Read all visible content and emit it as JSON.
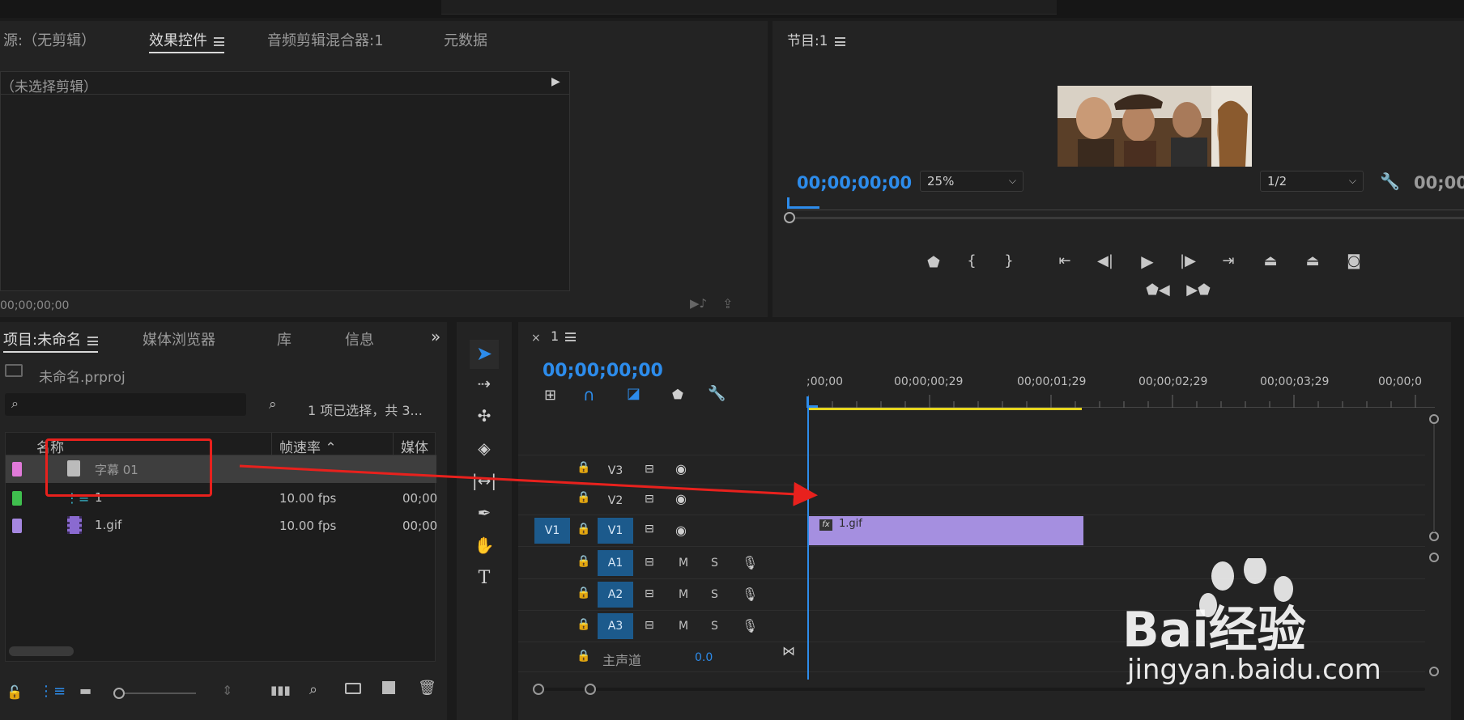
{
  "source_panel": {
    "tabs": [
      "源:（无剪辑）",
      "效果控件",
      "音频剪辑混合器:1",
      "元数据"
    ],
    "active_tab": 1,
    "no_clip_label": "（未选择剪辑）",
    "timecode": "00;00;00;00"
  },
  "program_monitor": {
    "title": "节目:1",
    "timecode": "00;00;00;00",
    "timecode_right": "00;00;",
    "zoom": "25%",
    "resolution": "1/2"
  },
  "project_panel": {
    "tabs": [
      "项目:未命名",
      "媒体浏览器",
      "库",
      "信息"
    ],
    "project_file": "未命名.prproj",
    "selection_status": "1 项已选择，共 3...",
    "columns": [
      "名称",
      "帧速率",
      "媒体"
    ],
    "items": [
      {
        "name": "字幕 01",
        "fps": "",
        "media": "",
        "color": "#e07ad9",
        "icon": "title-icon",
        "selected": true
      },
      {
        "name": "1",
        "fps": "10.00 fps",
        "media": "00;00",
        "color": "#3fbf4e",
        "icon": "sequence-icon",
        "selected": false
      },
      {
        "name": "1.gif",
        "fps": "10.00 fps",
        "media": "00;00",
        "color": "#a587e0",
        "icon": "film-icon",
        "selected": false
      }
    ]
  },
  "timeline": {
    "sequence_name": "1",
    "timecode": "00;00;00;00",
    "ruler_labels": [
      ";00;00",
      "00;00;00;29",
      "00;00;01;29",
      "00;00;02;29",
      "00;00;03;29",
      "00;00;0"
    ],
    "video_tracks": [
      "V3",
      "V2",
      "V1"
    ],
    "source_patch": "V1",
    "audio_tracks": [
      "A1",
      "A2",
      "A3"
    ],
    "mute_label": "M",
    "solo_label": "S",
    "master_label": "主声道",
    "master_value": "0.0",
    "clip": {
      "name": "1.gif",
      "fx": "fx",
      "color": "#a58fe0"
    }
  },
  "watermark": {
    "brand": "Bai经验",
    "url": "jingyan.baidu.com"
  }
}
